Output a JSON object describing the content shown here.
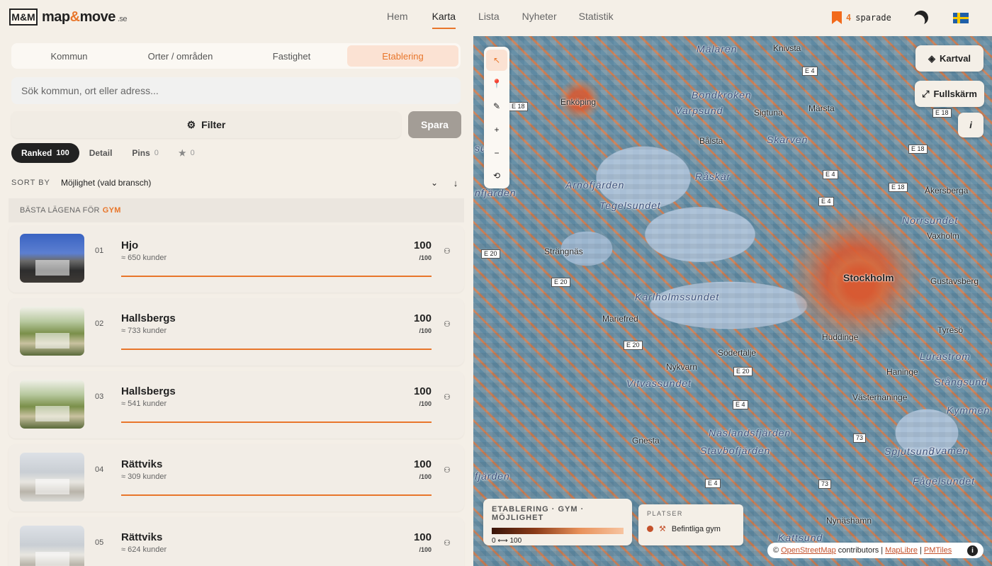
{
  "header": {
    "logo_mark": "M&M",
    "logo_name_a": "map",
    "logo_name_amp": "&",
    "logo_name_b": "move",
    "logo_tld": ".se",
    "nav": [
      "Hem",
      "Karta",
      "Lista",
      "Nyheter",
      "Statistik"
    ],
    "active_nav": "Karta",
    "saved_count": "4",
    "saved_label": "sparade"
  },
  "panel": {
    "tabs": [
      "Kommun",
      "Orter / områden",
      "Fastighet",
      "Etablering"
    ],
    "active_tab": "Etablering",
    "search_placeholder": "Sök kommun, ort eller adress...",
    "filter_icon": "⚙",
    "filter_label": "Filter",
    "save_label": "Spara",
    "chips": [
      {
        "label": "Ranked",
        "count": "100"
      },
      {
        "label": "Detail",
        "count": ""
      },
      {
        "label": "Pins",
        "count": "0"
      },
      {
        "label": "★",
        "count": "0"
      }
    ],
    "sort_label": "SORT BY",
    "sort_value": "Möjlighet (vald bransch)",
    "best_prefix": "BÄSTA LÄGENA FÖR",
    "best_industry": "GYM",
    "results": [
      {
        "rank": "01",
        "name": "Hjo",
        "customers": "≈ 650 kunder",
        "score": "100",
        "max": "/100",
        "fill": 1.0
      },
      {
        "rank": "02",
        "name": "Hallsbergs",
        "customers": "≈ 733 kunder",
        "score": "100",
        "max": "/100",
        "fill": 1.0
      },
      {
        "rank": "03",
        "name": "Hallsbergs",
        "customers": "≈ 541 kunder",
        "score": "100",
        "max": "/100",
        "fill": 1.0
      },
      {
        "rank": "04",
        "name": "Rättviks",
        "customers": "≈ 309 kunder",
        "score": "100",
        "max": "/100",
        "fill": 1.0
      },
      {
        "rank": "05",
        "name": "Rättviks",
        "customers": "≈ 624 kunder",
        "score": "100",
        "max": "/100",
        "fill": 1.0
      }
    ]
  },
  "map": {
    "tools": [
      "↖",
      "📍",
      "✎",
      "+",
      "−",
      "⟲"
    ],
    "layer_btn": "Kartval",
    "fullscreen_btn": "Fullskärm",
    "info_btn": "i",
    "labels": {
      "malaren": "Mälaren",
      "knivsta": "Knivsta",
      "enkoping": "Enköping",
      "bondkroken": "Bondkroken",
      "varpsund": "Varpsund",
      "sigtuna": "Sigtuna",
      "marsta": "Märsta",
      "balsta": "Bålsta",
      "skarven": "Skarven",
      "raskar": "Råskär",
      "arnofjarden": "Arnöfjärden",
      "tegelsundet": "Tegelsundet",
      "akersberga": "Åkersberga",
      "norrsundet": "Norrsundet",
      "vaxholm": "Vaxholm",
      "strangnas": "Strängnäs",
      "stockholm": "Stockholm",
      "gustavsberg": "Gustavsberg",
      "karlholmssundet": "Karlholmssundet",
      "mariefred": "Mariefred",
      "huddinge": "Huddinge",
      "tyreso": "Tyresö",
      "sodertalje": "Södertälje",
      "nykvarn": "Nykvarn",
      "haninge": "Haninge",
      "vitvassundet": "Vitvassundet",
      "vasterhaninge": "Västerhaninge",
      "naslandsfjarden": "Näslandsfjärden",
      "stavbofjarden": "Stavbofjärden",
      "gnesta": "Gnesta",
      "nynashamn": "Nynäshamn",
      "sundet": "sundet",
      "njfjarden": "nfjärden",
      "fagelsundet": "Fågelsundet",
      "lurastrom": "Lurastrom",
      "stangsund": "Stångsund",
      "kymmen": "Kymmen",
      "svamen": "Svamen",
      "spjutsund": "Spjutsund",
      "kattsund": "Kattsund",
      "fjarden": "fjärden"
    },
    "roads": [
      "E 4",
      "E 18",
      "E 18",
      "E 18",
      "E 18",
      "E 4",
      "E 4",
      "E 20",
      "E 20",
      "E 20",
      "E 20",
      "E 4",
      "E 4",
      "73",
      "73"
    ],
    "legend_title": "ETABLERING · GYM · MÖJLIGHET",
    "legend_range": "0 ⟷ 100",
    "places_title": "PLATSER",
    "places_item": "Befintliga gym",
    "attr_prefix": "©",
    "attr_osm": "OpenStreetMap",
    "attr_contrib": "contributors |",
    "attr_maplibre": "MapLibre",
    "attr_sep": "|",
    "attr_pmtiles": "PMTiles"
  }
}
